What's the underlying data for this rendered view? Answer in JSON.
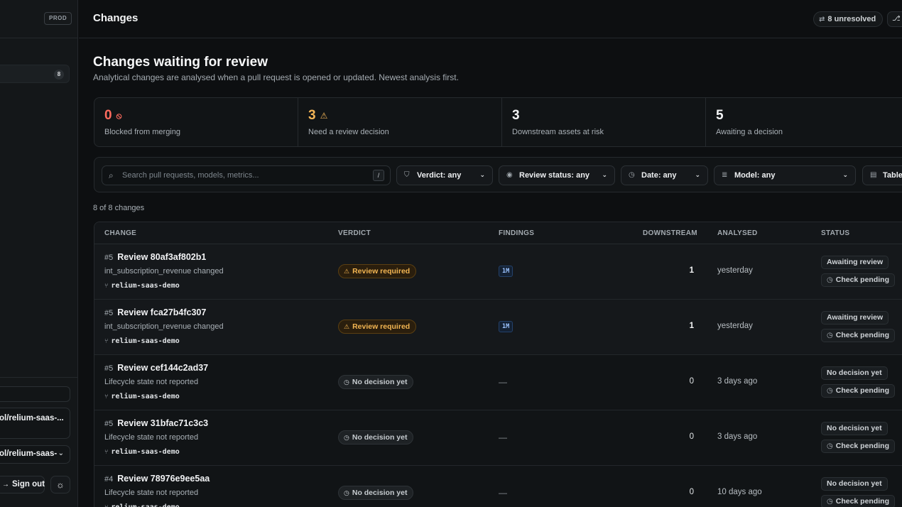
{
  "sidebar": {
    "env_badge": "PROD",
    "nav_count": "8",
    "repo_name": "ol/relium-saas-...",
    "repo_select": "ol/relium-saas-",
    "sign_out": "Sign out"
  },
  "topbar": {
    "title": "Changes",
    "unresolved": "8 unresolved"
  },
  "page": {
    "title": "Changes waiting for review",
    "subtitle": "Analytical changes are analysed when a pull request is opened or updated. Newest analysis first."
  },
  "stats": [
    {
      "value": "0",
      "label": "Blocked from merging",
      "icon": "⦸"
    },
    {
      "value": "3",
      "label": "Need a review decision",
      "icon": "⚠"
    },
    {
      "value": "3",
      "label": "Downstream assets at risk"
    },
    {
      "value": "5",
      "label": "Awaiting a decision"
    }
  ],
  "filters": {
    "search_placeholder": "Search pull requests, models, metrics...",
    "search_shortcut": "/",
    "verdict": "Verdict: any",
    "review_status": "Review status: any",
    "date": "Date: any",
    "model": "Model: any",
    "view": "Table"
  },
  "count_text": "8 of 8 changes",
  "table": {
    "headers": [
      "CHANGE",
      "VERDICT",
      "FINDINGS",
      "DOWNSTREAM",
      "ANALYSED",
      "STATUS"
    ],
    "rows": [
      {
        "num": "#5",
        "title": "Review 80af3af802b1",
        "desc": "int_subscription_revenue changed",
        "repo": "relium-saas-demo",
        "verdict": "Review required",
        "finding": "1M",
        "downstream": "1",
        "analysed": "yesterday",
        "status": "Awaiting review",
        "check": "Check pending"
      },
      {
        "num": "#5",
        "title": "Review fca27b4fc307",
        "desc": "int_subscription_revenue changed",
        "repo": "relium-saas-demo",
        "verdict": "Review required",
        "finding": "1M",
        "downstream": "1",
        "analysed": "yesterday",
        "status": "Awaiting review",
        "check": "Check pending"
      },
      {
        "num": "#5",
        "title": "Review cef144c2ad37",
        "desc": "Lifecycle state not reported",
        "repo": "relium-saas-demo",
        "verdict": "No decision yet",
        "finding": "—",
        "downstream": "0",
        "analysed": "3 days ago",
        "status": "No decision yet",
        "check": "Check pending"
      },
      {
        "num": "#5",
        "title": "Review 31bfac71c3c3",
        "desc": "Lifecycle state not reported",
        "repo": "relium-saas-demo",
        "verdict": "No decision yet",
        "finding": "—",
        "downstream": "0",
        "analysed": "3 days ago",
        "status": "No decision yet",
        "check": "Check pending"
      },
      {
        "num": "#4",
        "title": "Review 78976e9ee5aa",
        "desc": "Lifecycle state not reported",
        "repo": "relium-saas-demo",
        "verdict": "No decision yet",
        "finding": "—",
        "downstream": "0",
        "analysed": "10 days ago",
        "status": "No decision yet",
        "check": "Check pending"
      }
    ]
  },
  "colors": {
    "blocked": "#ff6b5e",
    "warning": "#f3b557",
    "accent_chip": "#9cc4ff"
  }
}
